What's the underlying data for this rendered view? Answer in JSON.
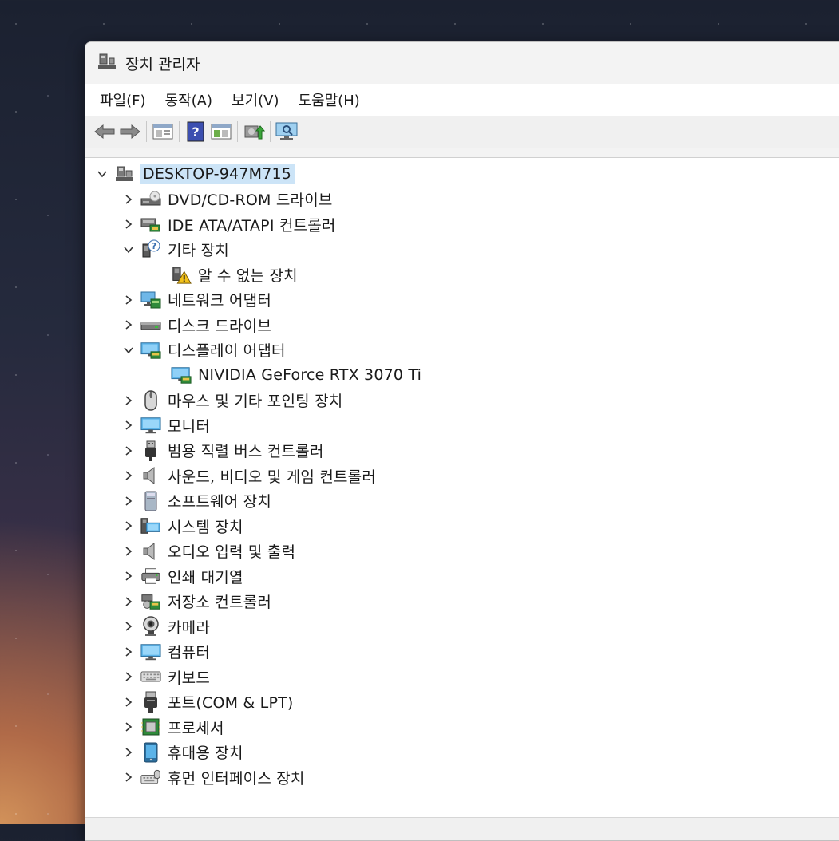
{
  "window": {
    "title": "장치 관리자"
  },
  "menu": [
    "파일(F)",
    "동작(A)",
    "보기(V)",
    "도움말(H)"
  ],
  "toolbar": [
    "back-icon",
    "forward-icon",
    "properties-icon",
    "help-icon",
    "view-icon",
    "update-driver-icon",
    "scan-hardware-icon"
  ],
  "tree": {
    "root": "DESKTOP-947M715",
    "items": [
      {
        "label": "DVD/CD-ROM 드라이브",
        "icon": "dvd-drive-icon",
        "expanded": false,
        "children": []
      },
      {
        "label": "IDE ATA/ATAPI 컨트롤러",
        "icon": "ide-controller-icon",
        "expanded": false,
        "children": []
      },
      {
        "label": "기타 장치",
        "icon": "other-devices-icon",
        "expanded": true,
        "children": [
          {
            "label": "알 수 없는 장치",
            "icon": "unknown-device-warning-icon"
          }
        ]
      },
      {
        "label": "네트워크 어댑터",
        "icon": "network-adapter-icon",
        "expanded": false,
        "children": []
      },
      {
        "label": "디스크 드라이브",
        "icon": "disk-drive-icon",
        "expanded": false,
        "children": []
      },
      {
        "label": "디스플레이 어댑터",
        "icon": "display-adapter-icon",
        "expanded": true,
        "children": [
          {
            "label": "NIVIDIA GeForce RTX 3070 Ti",
            "icon": "gpu-icon"
          }
        ]
      },
      {
        "label": "마우스 및 기타 포인팅 장치",
        "icon": "mouse-icon",
        "expanded": false,
        "children": []
      },
      {
        "label": "모니터",
        "icon": "monitor-icon",
        "expanded": false,
        "children": []
      },
      {
        "label": "범용 직렬 버스 컨트롤러",
        "icon": "usb-icon",
        "expanded": false,
        "children": []
      },
      {
        "label": "사운드, 비디오 및 게임 컨트롤러",
        "icon": "speaker-icon",
        "expanded": false,
        "children": []
      },
      {
        "label": "소프트웨어 장치",
        "icon": "software-device-icon",
        "expanded": false,
        "children": []
      },
      {
        "label": "시스템 장치",
        "icon": "system-device-icon",
        "expanded": false,
        "children": []
      },
      {
        "label": "오디오 입력 및 출력",
        "icon": "audio-io-icon",
        "expanded": false,
        "children": []
      },
      {
        "label": "인쇄 대기열",
        "icon": "printer-icon",
        "expanded": false,
        "children": []
      },
      {
        "label": "저장소 컨트롤러",
        "icon": "storage-controller-icon",
        "expanded": false,
        "children": []
      },
      {
        "label": "카메라",
        "icon": "camera-icon",
        "expanded": false,
        "children": []
      },
      {
        "label": "컴퓨터",
        "icon": "computer-icon",
        "expanded": false,
        "children": []
      },
      {
        "label": "키보드",
        "icon": "keyboard-icon",
        "expanded": false,
        "children": []
      },
      {
        "label": "포트(COM & LPT)",
        "icon": "port-icon",
        "expanded": false,
        "children": []
      },
      {
        "label": "프로세서",
        "icon": "processor-icon",
        "expanded": false,
        "children": []
      },
      {
        "label": "휴대용 장치",
        "icon": "portable-device-icon",
        "expanded": false,
        "children": []
      },
      {
        "label": "휴먼 인터페이스 장치",
        "icon": "hid-icon",
        "expanded": false,
        "children": []
      }
    ]
  }
}
